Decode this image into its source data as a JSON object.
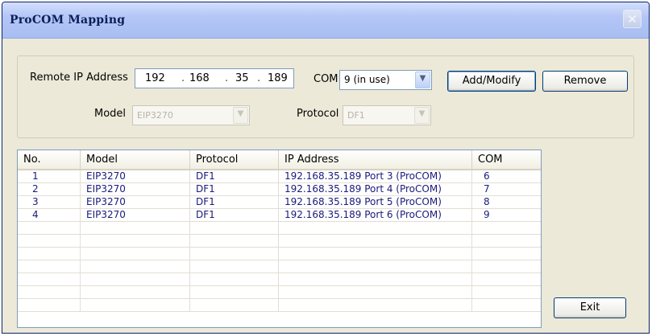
{
  "window": {
    "title": "ProCOM Mapping",
    "close_glyph": "✕"
  },
  "form": {
    "remote_ip_label": "Remote IP Address",
    "ip_octets": [
      "192",
      "168",
      "35",
      "189"
    ],
    "com_label": "COM",
    "com_value": "9 (in use)",
    "model_label": "Model",
    "model_value": "EIP3270",
    "protocol_label": "Protocol",
    "protocol_value": "DF1",
    "add_modify_button": "Add/Modify",
    "remove_button": "Remove",
    "dropdown_glyph": "▼"
  },
  "table": {
    "columns": [
      "No.",
      "Model",
      "Protocol",
      "IP Address",
      "COM"
    ],
    "rows": [
      [
        "1",
        "EIP3270",
        "DF1",
        "192.168.35.189 Port 3 (ProCOM)",
        "6"
      ],
      [
        "2",
        "EIP3270",
        "DF1",
        "192.168.35.189 Port 4 (ProCOM)",
        "7"
      ],
      [
        "3",
        "EIP3270",
        "DF1",
        "192.168.35.189 Port 5 (ProCOM)",
        "8"
      ],
      [
        "4",
        "EIP3270",
        "DF1",
        "192.168.35.189 Port 6 (ProCOM)",
        "9"
      ]
    ],
    "empty_rows": 7
  },
  "exit_button": "Exit",
  "icons": {
    "close": "close-icon",
    "dropdown": "chevron-down-icon"
  },
  "colors": {
    "title_bar": "#b4c6f6",
    "window_background": "#ece9d8",
    "row_text": "#1a1a7c",
    "button_border": "#003c74"
  }
}
